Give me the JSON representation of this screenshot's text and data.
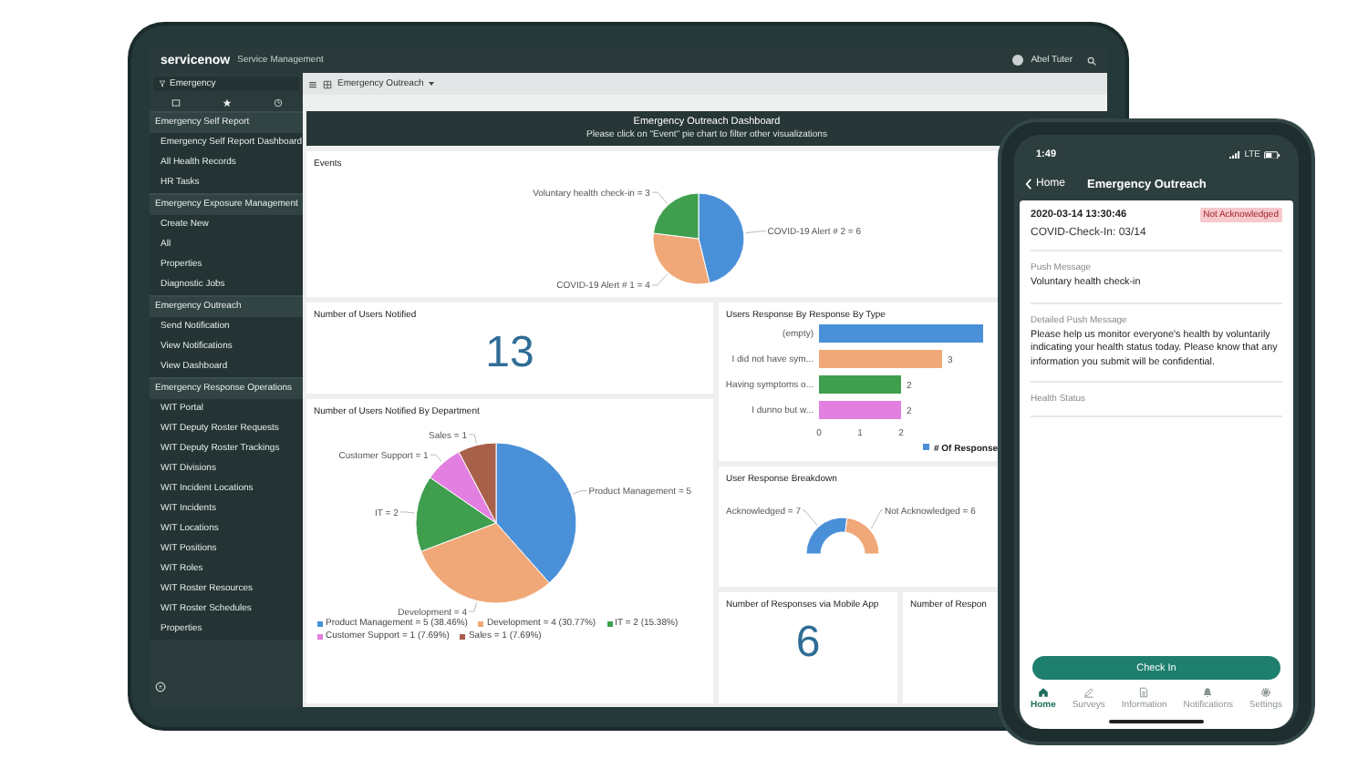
{
  "tablet": {
    "header": {
      "logo": "servicenow",
      "product": "Service Management",
      "user": "Abel Tuter"
    },
    "sidebar": {
      "search": {
        "value": "Emergency"
      },
      "sections": [
        {
          "title": "Emergency Self Report",
          "items": [
            "Emergency Self Report Dashboard",
            "All Health Records",
            "HR Tasks"
          ]
        },
        {
          "title": "Emergency Exposure Management",
          "items": [
            "Create New",
            "All",
            "Properties",
            "Diagnostic Jobs"
          ]
        },
        {
          "title": "Emergency Outreach",
          "items": [
            "Send Notification",
            "View Notifications",
            "View Dashboard"
          ]
        },
        {
          "title": "Emergency Response Operations",
          "items": [
            "WIT Portal",
            "WIT Deputy Roster Requests",
            "WIT Deputy Roster Trackings",
            "WIT Divisions",
            "WIT Incident Locations",
            "WIT Incidents",
            "WIT Locations",
            "WIT Positions",
            "WIT Roles",
            "WIT Roster Resources",
            "WIT Roster Schedules",
            "Properties"
          ]
        }
      ]
    },
    "toolbar": {
      "title": "Emergency Outreach"
    },
    "banner": {
      "title": "Emergency Outreach Dashboard",
      "subtitle": "Please click on \"Event\" pie chart to filter other visualizations"
    },
    "events": {
      "chart_data": {
        "type": "pie",
        "title": "Events",
        "categories": [
          "COVID-19 Alert # 2",
          "COVID-19 Alert # 1",
          "Voluntary health check-in"
        ],
        "values": [
          6,
          4,
          3
        ],
        "value_labels": [
          "= 6",
          "= 4",
          "= 3"
        ]
      }
    },
    "users_notified": {
      "title": "Number of Users Notified",
      "value": "13"
    },
    "by_department": {
      "chart_data": {
        "type": "pie",
        "title": "Number of Users Notified By Department",
        "categories": [
          "Product Management",
          "Development",
          "IT",
          "Customer Support",
          "Sales"
        ],
        "values": [
          5,
          4,
          2,
          1,
          1
        ],
        "value_labels": [
          "= 5",
          "= 4",
          "= 2",
          "= 1",
          "= 1"
        ]
      },
      "legend": [
        "Product Management = 5 (38.46%)",
        "Development = 4 (30.77%)",
        "IT = 2 (15.38%)",
        "Customer Support = 1 (7.69%)",
        "Sales = 1 (7.69%)"
      ]
    },
    "by_type": {
      "chart_data": {
        "type": "bar",
        "orientation": "horizontal",
        "title": "Users Response By Response By Type",
        "categories": [
          "(empty)",
          "I did not have sym...",
          "Having symptoms o...",
          "I dunno but w..."
        ],
        "series": [
          {
            "name": "# Of Response",
            "values": [
              4,
              3,
              2,
              2
            ]
          }
        ],
        "xlim": [
          0,
          4
        ],
        "xticks": [
          0,
          1,
          2
        ],
        "value_labels": [
          null,
          "3",
          "2",
          "2"
        ]
      }
    },
    "breakdown": {
      "chart_data": {
        "type": "donut",
        "title": "User Response Breakdown",
        "categories": [
          "Acknowledged",
          "Not Acknowledged"
        ],
        "values": [
          7,
          6
        ],
        "value_labels": [
          "= 7",
          "= 6"
        ]
      }
    },
    "tiles": [
      {
        "title": "Number of Responses via Mobile App",
        "value": "6"
      },
      {
        "title": "Number of Respon"
      }
    ]
  },
  "phone": {
    "status": {
      "time": "1:49",
      "network": "LTE"
    },
    "nav": {
      "back": "Home",
      "title": "Emergency Outreach"
    },
    "record": {
      "timestamp": "2020-03-14 13:30:46",
      "badge": "Not Acknowledged",
      "name": "COVID-Check-In: 03/14"
    },
    "fields": [
      {
        "label": "Push Message",
        "value": "Voluntary health check-in"
      },
      {
        "label": "Detailed Push Message",
        "value": "Please help us monitor everyone's health by voluntarily indicating your health status today. Please know that any information you submit will be confidential."
      },
      {
        "label": "Health Status"
      }
    ],
    "button": "Check In",
    "tabs": [
      {
        "label": "Home",
        "kind": "home",
        "selected": true
      },
      {
        "label": "Surveys",
        "kind": "pencil",
        "selected": false
      },
      {
        "label": "Information",
        "kind": "document",
        "selected": false
      },
      {
        "label": "Notifications",
        "kind": "bell",
        "selected": false
      },
      {
        "label": "Settings",
        "kind": "gear",
        "selected": false
      }
    ]
  }
}
